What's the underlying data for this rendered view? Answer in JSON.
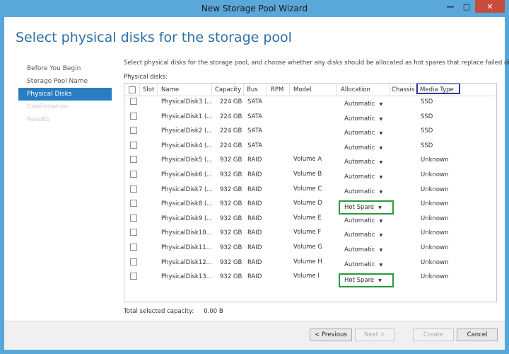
{
  "window": {
    "title": "New Storage Pool Wizard",
    "minimize": "—",
    "maximize": "□",
    "close": "✕"
  },
  "page": {
    "heading": "Select physical disks for the storage pool"
  },
  "nav": {
    "items": [
      {
        "label": "Before You Begin",
        "state": "normal"
      },
      {
        "label": "Storage Pool Name",
        "state": "normal"
      },
      {
        "label": "Physical Disks",
        "state": "active"
      },
      {
        "label": "Confirmation",
        "state": "disabled"
      },
      {
        "label": "Results",
        "state": "disabled"
      }
    ]
  },
  "content": {
    "description": "Select physical disks for the storage pool, and choose whether any disks should be allocated as hot spares that replace failed disks.",
    "disks_label": "Physical disks:",
    "columns": [
      "Slot",
      "Name",
      "Capacity",
      "Bus",
      "RPM",
      "Model",
      "Allocation",
      "Chassis",
      "Media Type"
    ],
    "rows": [
      {
        "name": "PhysicalDisk3 (...",
        "capacity": "224 GB",
        "bus": "SATA",
        "model": "",
        "allocation": "Automatic",
        "media": "SSD"
      },
      {
        "name": "PhysicalDisk1 (...",
        "capacity": "224 GB",
        "bus": "SATA",
        "model": "",
        "allocation": "Automatic",
        "media": "SSD"
      },
      {
        "name": "PhysicalDisk2 (...",
        "capacity": "224 GB",
        "bus": "SATA",
        "model": "",
        "allocation": "Automatic",
        "media": "SSD"
      },
      {
        "name": "PhysicalDisk4 (...",
        "capacity": "224 GB",
        "bus": "SATA",
        "model": "",
        "allocation": "Automatic",
        "media": "SSD"
      },
      {
        "name": "PhysicalDisk5 (...",
        "capacity": "932 GB",
        "bus": "RAID",
        "model": "Volume A",
        "allocation": "Automatic",
        "media": "Unknown"
      },
      {
        "name": "PhysicalDisk6 (...",
        "capacity": "932 GB",
        "bus": "RAID",
        "model": "Volume B",
        "allocation": "Automatic",
        "media": "Unknown"
      },
      {
        "name": "PhysicalDisk7 (...",
        "capacity": "932 GB",
        "bus": "RAID",
        "model": "Volume C",
        "allocation": "Automatic",
        "media": "Unknown"
      },
      {
        "name": "PhysicalDisk8 (...",
        "capacity": "932 GB",
        "bus": "RAID",
        "model": "Volume D",
        "allocation": "Hot Spare",
        "media": "Unknown"
      },
      {
        "name": "PhysicalDisk9 (...",
        "capacity": "932 GB",
        "bus": "RAID",
        "model": "Volume E",
        "allocation": "Automatic",
        "media": "Unknown"
      },
      {
        "name": "PhysicalDisk10...",
        "capacity": "932 GB",
        "bus": "RAID",
        "model": "Volume F",
        "allocation": "Automatic",
        "media": "Unknown"
      },
      {
        "name": "PhysicalDisk11...",
        "capacity": "932 GB",
        "bus": "RAID",
        "model": "Volume G",
        "allocation": "Automatic",
        "media": "Unknown"
      },
      {
        "name": "PhysicalDisk12...",
        "capacity": "932 GB",
        "bus": "RAID",
        "model": "Volume H",
        "allocation": "Automatic",
        "media": "Unknown"
      },
      {
        "name": "PhysicalDisk13...",
        "capacity": "932 GB",
        "bus": "RAID",
        "model": "Volume I",
        "allocation": "Hot Spare",
        "media": "Unknown"
      }
    ],
    "total_label": "Total selected capacity:",
    "total_value": "0.00 B"
  },
  "footer": {
    "previous": "< Previous",
    "next": "Next >",
    "create": "Create",
    "cancel": "Cancel"
  },
  "colors": {
    "accent": "#2a7dbf",
    "highlight_media": "#2d3a9a",
    "highlight_hotspare": "#2a9a3c"
  }
}
